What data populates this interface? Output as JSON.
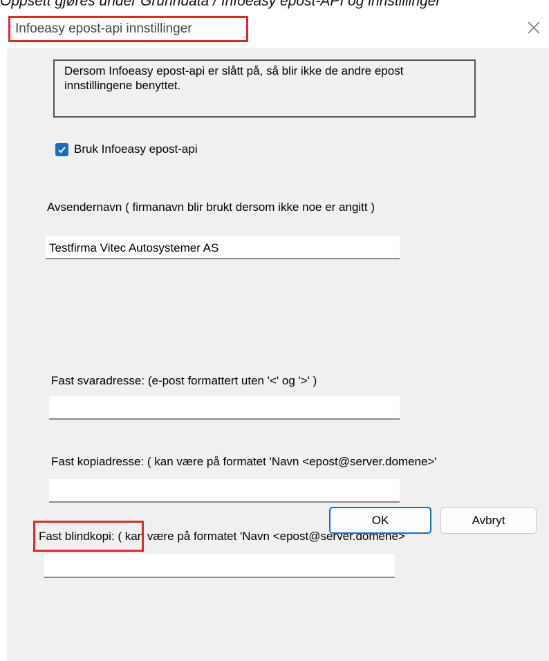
{
  "caption": "Oppsett gjøres under Grunndata / Infoeasy epost-API og innstillinger",
  "dialog": {
    "title": "Infoeasy epost-api innstillinger",
    "close_icon": "close-icon"
  },
  "info_text": "Dersom Infoeasy epost-api er slått på, så blir ikke de andre epost innstillingene benyttet.",
  "use_api": {
    "label": "Bruk Infoeasy epost-api",
    "checked": true
  },
  "sender": {
    "label": "Avsendernavn ( firmanavn blir brukt dersom ikke noe er angitt )",
    "value": "Testfirma Vitec Autosystemer AS"
  },
  "reply": {
    "label": "Fast svaradresse: (e-post formattert uten '<' og '>' )",
    "value": ""
  },
  "copy": {
    "label": "Fast kopiadresse: ( kan være på formatet 'Navn <epost@server.domene>'",
    "value": ""
  },
  "bcc": {
    "label_main": "Fast blindkopi:",
    "label_rest": " ( kan være på formatet 'Navn <epost@server.domene>'",
    "value": ""
  },
  "buttons": {
    "ok": "OK",
    "cancel": "Avbryt"
  },
  "colors": {
    "highlight": "#e0252b",
    "accent": "#1e6ab8"
  }
}
